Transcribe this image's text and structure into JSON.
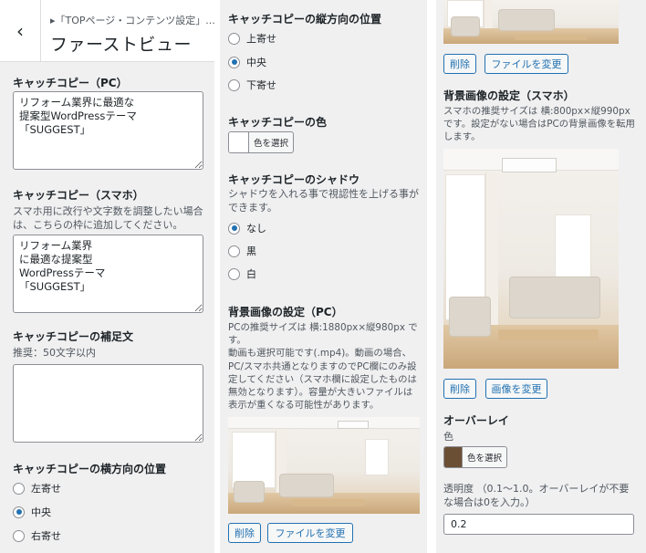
{
  "header": {
    "back_icon": "‹",
    "breadcrumb": "▸「TOPページ・コンテンツ設定」...",
    "title": "ファーストビュー"
  },
  "catch_pc": {
    "label": "キャッチコピー（PC）",
    "value": "リフォーム業界に最適な\n提案型WordPressテーマ\n「SUGGEST」"
  },
  "catch_sp": {
    "label": "キャッチコピー（スマホ）",
    "description": "スマホ用に改行や文字数を調整したい場合は、こちらの枠に追加してください。",
    "value": "リフォーム業界\nに最適な提案型\nWordPressテーマ\n「SUGGEST」"
  },
  "catch_sub": {
    "label": "キャッチコピーの補足文",
    "description": "推奨：50文字以内",
    "value": ""
  },
  "horizontal": {
    "label": "キャッチコピーの横方向の位置",
    "options": [
      "左寄せ",
      "中央",
      "右寄せ"
    ],
    "selected": "中央"
  },
  "vertical": {
    "label": "キャッチコピーの縦方向の位置",
    "options": [
      "上寄せ",
      "中央",
      "下寄せ"
    ],
    "selected": "中央"
  },
  "catch_color": {
    "label": "キャッチコピーの色",
    "button": "色を選択",
    "color": "#ffffff"
  },
  "shadow": {
    "label": "キャッチコピーのシャドウ",
    "description": "シャドウを入れる事で視認性を上げる事ができます。",
    "options": [
      "なし",
      "黒",
      "白"
    ],
    "selected": "なし"
  },
  "bg_pc": {
    "label": "背景画像の設定（PC）",
    "description": "PCの推奨サイズは 横:1880px×縦980px です。\n動画も選択可能です(.mp4)。動画の場合、PC/スマホ共通となりますのでPC欄にのみ設定してください（スマホ欄に設定したものは無効となります）。容量が大きいファイルは表示が重くなる可能性があります。",
    "remove": "削除",
    "change": "ファイルを変更"
  },
  "bg_top": {
    "remove": "削除",
    "change": "ファイルを変更"
  },
  "bg_sp": {
    "label": "背景画像の設定（スマホ）",
    "description": "スマホの推奨サイズは 横:800px×縦990px です。設定がない場合はPCの背景画像を転用します。",
    "remove": "削除",
    "change": "画像を変更"
  },
  "overlay": {
    "label": "オーバーレイ",
    "color_label": "色",
    "button": "色を選択",
    "color": "#6b4f35",
    "opacity_label": "透明度 （0.1〜1.0。オーバーレイが不要な場合は0を入力。）",
    "opacity_value": "0.2"
  },
  "colors": {
    "accent": "#2271b1",
    "panel_bg": "#f0f0f1"
  }
}
